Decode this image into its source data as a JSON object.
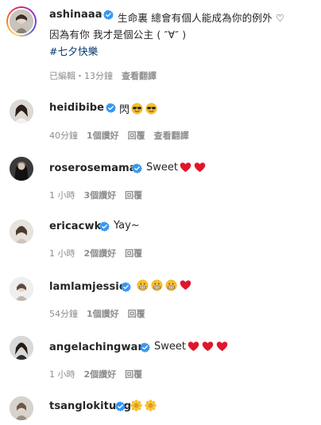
{
  "post": {
    "username": "ashinaaa",
    "caption_line1": "生命裏 總會有個人能成為你的例外 ♡",
    "caption_line2": "因為有你 我才是個公主 ( ″∀″ )",
    "hashtag": "#七夕快樂",
    "meta": {
      "edited": "已編輯・13分鐘",
      "translate": "查看翻譯"
    }
  },
  "comments": [
    {
      "username": "heidibibe",
      "text": "閃",
      "emojis": [
        "sunglasses-face",
        "sunglasses-face"
      ],
      "time": "40分鐘",
      "likes": "1個讚好",
      "reply": "回覆",
      "translate": "查看翻譯"
    },
    {
      "username": "roserosemama",
      "text": "Sweet",
      "emojis": [
        "red-heart",
        "red-heart"
      ],
      "time": "1 小時",
      "likes": "3個讚好",
      "reply": "回覆"
    },
    {
      "username": "ericacwk",
      "text": "Yay~",
      "emojis": [],
      "time": "1 小時",
      "likes": "2個讚好",
      "reply": "回覆"
    },
    {
      "username": "lamlamjessie",
      "text": "",
      "emojis": [
        "grimacing-face",
        "grimacing-face",
        "grimacing-face",
        "red-heart"
      ],
      "time": "54分鐘",
      "likes": "1個讚好",
      "reply": "回覆"
    },
    {
      "username": "angelachingwan",
      "text": "Sweet",
      "emojis": [
        "red-heart",
        "red-heart",
        "red-heart"
      ],
      "time": "1 小時",
      "likes": "2個讚好",
      "reply": "回覆"
    },
    {
      "username": "tsanglokitung",
      "text": "",
      "emojis": [
        "sun-flower",
        "sun-flower"
      ],
      "time": "",
      "likes": "",
      "reply": ""
    }
  ],
  "colors": {
    "verified": "#3897f0",
    "meta_text": "#8e8e8e",
    "hashtag": "#00376b",
    "heart": "#e0162b"
  }
}
